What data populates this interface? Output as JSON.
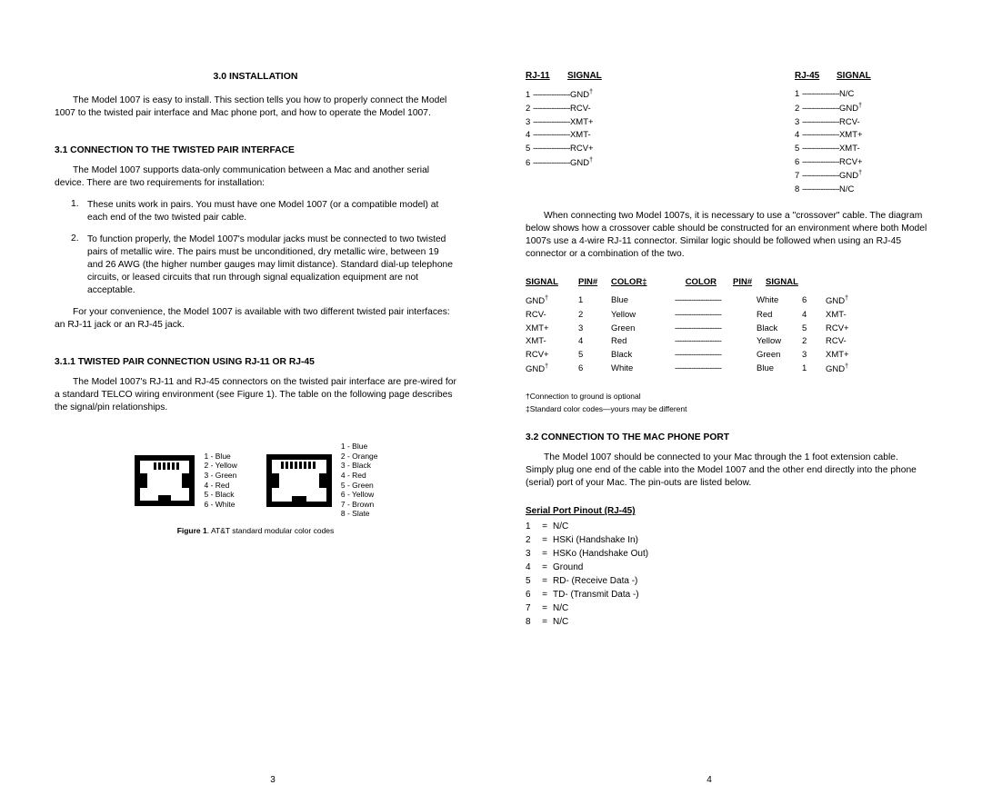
{
  "left": {
    "title": "3.0  INSTALLATION",
    "intro": "The Model 1007 is easy to install.  This section tells you how to properly connect the Model 1007 to the twisted pair interface and Mac phone port, and how to operate the Model 1007.",
    "h31": "3.1  CONNECTION TO THE TWISTED PAIR INTERFACE",
    "p31": "The Model 1007 supports data-only communication between a Mac and another serial device.  There are two requirements for installation:",
    "li1": "These units work in pairs.  You must have one Model 1007 (or a compatible model) at each end of the two twisted pair cable.",
    "li2": "To function properly, the Model 1007's modular jacks must be connected to two twisted pairs of metallic wire.  The pairs must be unconditioned, dry metallic wire, between 19 and 26 AWG (the higher number gauges may limit distance).  Standard dial-up telephone circuits, or leased circuits that run through signal equalization equipment are not acceptable.",
    "p31b": "For your convenience, the Model 1007 is available with two different twisted pair interfaces:  an RJ-11 jack or an RJ-45 jack.",
    "h311": "3.1.1  TWISTED PAIR CONNECTION USING RJ-11 OR RJ-45",
    "p311": "The Model 1007's RJ-11 and RJ-45 connectors on the twisted pair interface are pre-wired for a standard TELCO wiring environment (see Figure 1).  The table on the following page describes the signal/pin relationships.",
    "fig_rj11_labels": "1 - Blue\n2 - Yellow\n3 - Green\n4 - Red\n5 - Black\n6 - White",
    "fig_rj45_labels": "1 - Blue\n2 - Orange\n3 - Black\n4 - Red\n5 - Green\n6 - Yellow\n7 - Brown\n8 - Slate",
    "fig_caption_b": "Figure 1",
    "fig_caption": ".  AT&T standard modular color codes",
    "page": "3"
  },
  "right": {
    "rj11_hdr_a": "RJ-11",
    "rj11_hdr_b": "SIGNAL",
    "rj45_hdr_a": "RJ-45",
    "rj45_hdr_b": "SIGNAL",
    "rj11": [
      {
        "pin": "1",
        "sig": "GND",
        "sup": "†"
      },
      {
        "pin": "2",
        "sig": "RCV-"
      },
      {
        "pin": "3",
        "sig": "XMT+"
      },
      {
        "pin": "4",
        "sig": "XMT-"
      },
      {
        "pin": "5",
        "sig": "RCV+"
      },
      {
        "pin": "6",
        "sig": "GND",
        "sup": "†"
      }
    ],
    "rj45": [
      {
        "pin": "1",
        "sig": "N/C"
      },
      {
        "pin": "2",
        "sig": "GND",
        "sup": "†"
      },
      {
        "pin": "3",
        "sig": "RCV-"
      },
      {
        "pin": "4",
        "sig": "XMT+"
      },
      {
        "pin": "5",
        "sig": "XMT-"
      },
      {
        "pin": "6",
        "sig": "RCV+"
      },
      {
        "pin": "7",
        "sig": "GND",
        "sup": "†"
      },
      {
        "pin": "8",
        "sig": "N/C"
      }
    ],
    "crossover_para": "When connecting two Model 1007s, it is necessary to use a \"crossover\" cable.  The diagram below shows how a crossover cable should be constructed for an environment where both Model 1007s use a 4-wire RJ-11 connector.  Similar logic should be followed when using an RJ-45 connector or a combination of the two.",
    "cross_hdr": [
      "SIGNAL",
      "PIN#",
      "COLOR‡",
      "COLOR",
      "PIN#",
      "SIGNAL"
    ],
    "cross": [
      [
        "GND†",
        "1",
        "Blue",
        "White",
        "6",
        "GND†"
      ],
      [
        "RCV-",
        "2",
        "Yellow",
        "Red",
        "4",
        "XMT-"
      ],
      [
        "XMT+",
        "3",
        "Green",
        "Black",
        "5",
        "RCV+"
      ],
      [
        "XMT-",
        "4",
        "Red",
        "Yellow",
        "2",
        "RCV-"
      ],
      [
        "RCV+",
        "5",
        "Black",
        "Green",
        "3",
        "XMT+"
      ],
      [
        "GND†",
        "6",
        "White",
        "Blue",
        "1",
        "GND†"
      ]
    ],
    "foot1": "†Connection to ground is optional",
    "foot2": "‡Standard color codes—yours may be different",
    "h32": "3.2  CONNECTION TO THE MAC PHONE PORT",
    "p32": "The Model 1007 should be connected to your Mac through the 1 foot extension cable.  Simply plug one end of the cable into the Model 1007 and the other end directly into the phone (serial) port of your Mac.  The pin-outs are listed below.",
    "serial_title": "Serial Port Pinout (RJ-45)",
    "serial": [
      [
        "1",
        "N/C"
      ],
      [
        "2",
        "HSKi (Handshake In)"
      ],
      [
        "3",
        "HSKo (Handshake Out)"
      ],
      [
        "4",
        "Ground"
      ],
      [
        "5",
        "RD- (Receive Data -)"
      ],
      [
        "6",
        "TD- (Transmit Data -)"
      ],
      [
        "7",
        "N/C"
      ],
      [
        "8",
        "N/C"
      ]
    ],
    "page": "4"
  }
}
